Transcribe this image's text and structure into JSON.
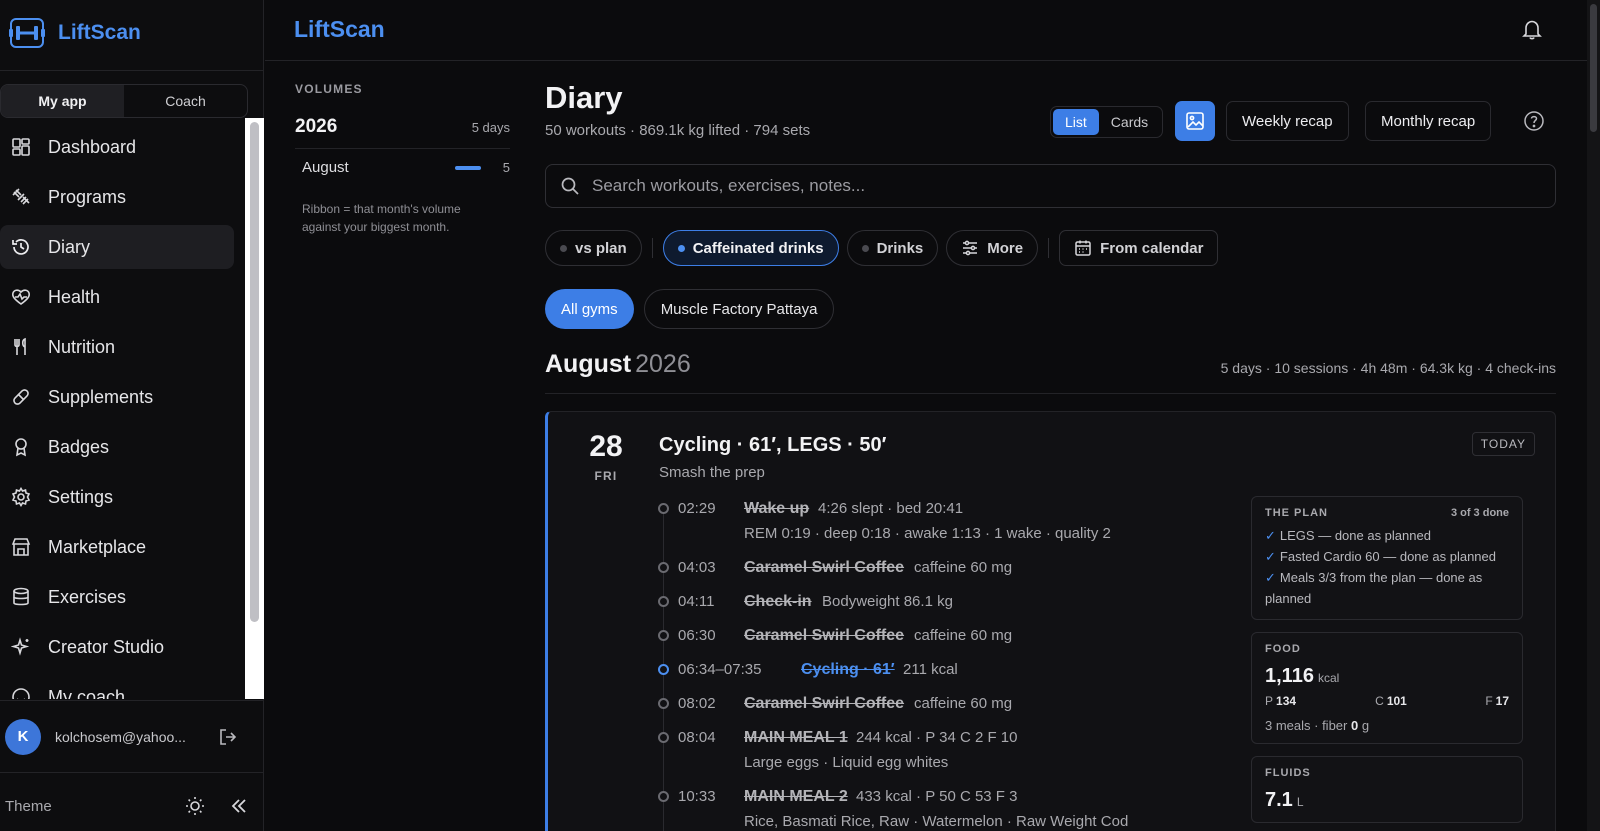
{
  "app": {
    "name": "LiftScan"
  },
  "sidebar": {
    "tabs": [
      {
        "label": "My app",
        "active": true
      },
      {
        "label": "Coach",
        "active": false
      }
    ],
    "items": [
      {
        "label": "Dashboard",
        "icon": "dashboard-icon"
      },
      {
        "label": "Programs",
        "icon": "programs-icon"
      },
      {
        "label": "Diary",
        "icon": "history-icon",
        "active": true
      },
      {
        "label": "Health",
        "icon": "heart-pulse-icon"
      },
      {
        "label": "Nutrition",
        "icon": "utensils-icon"
      },
      {
        "label": "Supplements",
        "icon": "pill-icon"
      },
      {
        "label": "Badges",
        "icon": "badge-icon"
      },
      {
        "label": "Settings",
        "icon": "gear-icon"
      },
      {
        "label": "Marketplace",
        "icon": "store-icon"
      },
      {
        "label": "Exercises",
        "icon": "database-icon"
      },
      {
        "label": "Creator Studio",
        "icon": "sparkle-icon"
      },
      {
        "label": "My coach",
        "icon": "coach-icon"
      }
    ],
    "user": {
      "initial": "K",
      "email": "kolchosem@yahoo..."
    },
    "theme_label": "Theme"
  },
  "topbar": {
    "title": "LiftScan"
  },
  "volumes": {
    "label": "VOLUMES",
    "year": "2026",
    "year_days": "5 days",
    "months": [
      {
        "name": "August",
        "count": "5",
        "ribbon_fraction": 1.0
      }
    ],
    "note": "Ribbon = that month's volume against your biggest month."
  },
  "diary": {
    "title": "Diary",
    "subtitle": "50 workouts · 869.1k kg lifted · 794 sets",
    "view_list": "List",
    "view_cards": "Cards",
    "weekly_recap": "Weekly recap",
    "monthly_recap": "Monthly recap",
    "search_placeholder": "Search workouts, exercises, notes...",
    "chips": {
      "vs_plan": "vs plan",
      "caffeinated": "Caffeinated drinks",
      "drinks": "Drinks",
      "more": "More",
      "from_calendar": "From calendar"
    },
    "gyms": {
      "all": "All gyms",
      "muscle_factory": "Muscle Factory Pattaya"
    },
    "month": {
      "name": "August",
      "year": "2026",
      "stats": "5 days · 10 sessions · 4h 48m · 64.3k kg · 4 check-ins"
    },
    "day": {
      "num": "28",
      "dow": "FRI",
      "title": "Cycling · 61′, LEGS · 50′",
      "subtitle": "Smash the prep",
      "badge": "TODAY",
      "events": [
        {
          "time": "02:29",
          "name": "Wake up",
          "detail": "4:26 slept · bed 20:41",
          "line2": "REM 0:19 · deep 0:18 · awake 1:13 · 1 wake · quality 2"
        },
        {
          "time": "04:03",
          "name": "Caramel Swirl Coffee",
          "detail": "caffeine 60 mg",
          "line2": ""
        },
        {
          "time": "04:11",
          "name": "Check-in",
          "detail": "Bodyweight 86.1 kg",
          "line2": ""
        },
        {
          "time": "06:30",
          "name": "Caramel Swirl Coffee",
          "detail": "caffeine 60 mg",
          "line2": ""
        },
        {
          "time": "06:34–07:35",
          "name": "Cycling · 61′",
          "detail": "211 kcal",
          "line2": ""
        },
        {
          "time": "08:02",
          "name": "Caramel Swirl Coffee",
          "detail": "caffeine 60 mg",
          "line2": ""
        },
        {
          "time": "08:04",
          "name": "MAIN MEAL 1",
          "detail": "244 kcal · P 34 C 2 F 10",
          "line2": "Large eggs · Liquid egg whites"
        },
        {
          "time": "10:33",
          "name": "MAIN MEAL 2",
          "detail": "433 kcal · P 50 C 53 F 3",
          "line2": "Rice, Basmati Rice, Raw · Watermelon · Raw Weight Cod"
        }
      ],
      "plan": {
        "header": "THE PLAN",
        "count": "3 of 3 done",
        "items": [
          "LEGS — done as planned",
          "Fasted Cardio 60 — done as planned",
          "Meals 3/3 from the plan — done as planned"
        ]
      },
      "food": {
        "header": "FOOD",
        "kcal": "1,116",
        "unit": "kcal",
        "p_label": "P",
        "p": "134",
        "c_label": "C",
        "c": "101",
        "f_label": "F",
        "f": "17",
        "meals": "3 meals · fiber",
        "fiber": "0",
        "fiber_unit": "g"
      },
      "fluids": {
        "header": "FLUIDS",
        "value": "7.1",
        "unit": "L"
      }
    }
  },
  "colors": {
    "accent": "#3d7ee6",
    "brand": "#4c8ff0",
    "background": "#0b0b0d"
  }
}
